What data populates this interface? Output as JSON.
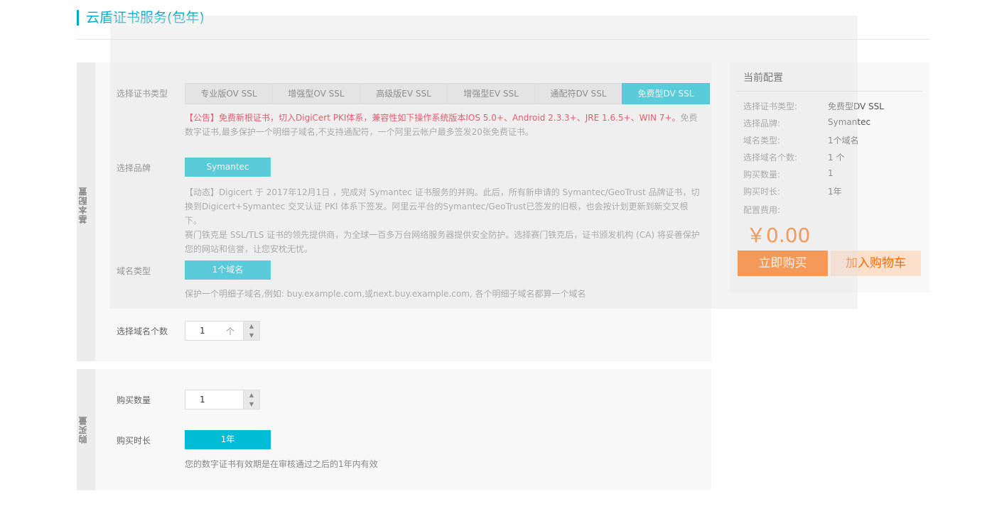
{
  "page": {
    "title": "云盾证书服务(包年)"
  },
  "sections": {
    "basic": "基本配置",
    "purchase": "购买量"
  },
  "cert_type": {
    "label": "选择证书类型",
    "tabs": [
      "专业版OV SSL",
      "增强型OV SSL",
      "高级版EV SSL",
      "增强型EV SSL",
      "通配符DV SSL",
      "免费型DV SSL"
    ],
    "selected": "免费型DV SSL",
    "notice_red": "【公告】免费新根证书，切入DigiCert PKI体系，兼容性如下操作系统版本IOS 5.0+、Android 2.3.3+、JRE 1.6.5+、WIN 7+。",
    "notice_gray": "免费数字证书,最多保护一个明细子域名,不支持通配符，一个阿里云帐户最多签发20张免费证书。"
  },
  "brand": {
    "label": "选择品牌",
    "value": "Symantec",
    "desc_line1": "【动态】Digicert 于 2017年12月1日 ，完成对 Symantec 证书服务的并购。此后，所有新申请的 Symantec/GeoTrust 品牌证书，切换到Digicert+Symantec 交叉认证 PKI 体系下签发。阿里云平台的Symantec/GeoTrust已签发的旧根，也会按计划更新到新交叉根下。",
    "desc_line2": "赛门铁克是 SSL/TLS 证书的领先提供商，为全球一百多万台网络服务器提供安全防护。选择赛门铁克后，证书颁发机构 (CA) 将妥善保护您的网站和信誉，让您安枕无忧。"
  },
  "domain_type": {
    "label": "域名类型",
    "value": "1个域名",
    "desc": "保护一个明细子域名,例如: buy.example.com,或next.buy.example.com, 各个明细子域名都算一个域名"
  },
  "domain_count": {
    "label": "选择域名个数",
    "value": "1",
    "unit": "个"
  },
  "quantity": {
    "label": "购买数量",
    "value": "1"
  },
  "duration": {
    "label": "购买时长",
    "value": "1年",
    "desc": "您的数字证书有效期是在审核通过之后的1年内有效"
  },
  "summary": {
    "title": "当前配置",
    "rows": [
      {
        "label": "选择证书类型:",
        "value": "免费型DV SSL"
      },
      {
        "label": "选择品牌:",
        "value": "Symantec"
      },
      {
        "label": "域名类型:",
        "value": "1个域名"
      },
      {
        "label": "选择域名个数:",
        "value": "1 个"
      },
      {
        "label": "购买数量:",
        "value": "1"
      },
      {
        "label": "购买时长:",
        "value": "1年"
      }
    ],
    "fee_label": "配置费用:",
    "price": "￥0.00",
    "buy_label": "立即购买",
    "cart_label": "加入购物车"
  },
  "colors": {
    "accent": "#00bcd4",
    "orange": "#ff6a00",
    "notice_red": "#e6001e"
  }
}
